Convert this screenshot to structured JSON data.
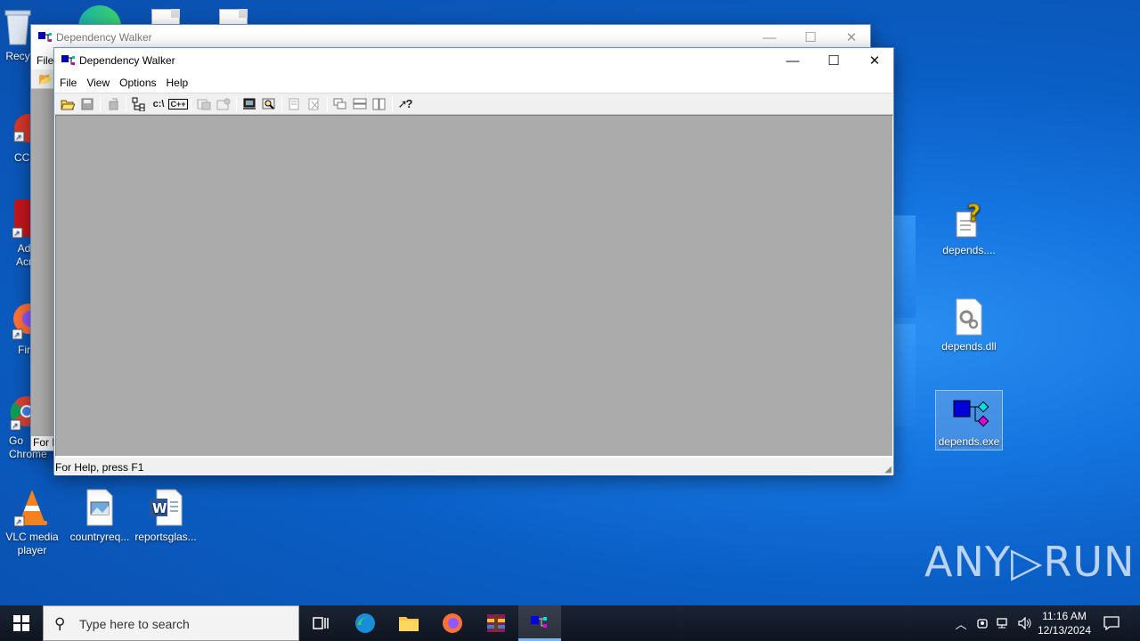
{
  "desktop": {
    "left_icons": [
      {
        "name": "recycle",
        "label": "Recy"
      },
      {
        "name": "ccleaner",
        "label": "CCl"
      },
      {
        "name": "acrobat",
        "label": "Ad\nAcr"
      },
      {
        "name": "firefox",
        "label": "Fir"
      },
      {
        "name": "chrome",
        "label": "Go\nChrome"
      }
    ],
    "bottom_icons": [
      {
        "label": "VLC media player"
      },
      {
        "label": "countryreq..."
      },
      {
        "label": "reportsglas..."
      }
    ],
    "right_icons": [
      {
        "label": "depends...."
      },
      {
        "label": "depends.dll"
      },
      {
        "label": "depends.exe"
      }
    ]
  },
  "back_window": {
    "title": "Dependency Walker",
    "menu_first": "File",
    "status_fragment": "For H"
  },
  "front_window": {
    "title": "Dependency Walker",
    "menu": [
      "File",
      "View",
      "Options",
      "Help"
    ],
    "toolbar_glyphs": {
      "c_drive": "c:\\",
      "cpp": "C++",
      "help": "?"
    },
    "status": "For Help, press F1"
  },
  "taskbar": {
    "search_placeholder": "Type here to search",
    "time": "11:16 AM",
    "date": "12/13/2024"
  },
  "watermark": "ANY▷RUN",
  "colors": {
    "desktop_blue": "#0a5ec4",
    "client_gray": "#ababab",
    "taskbar": "#0e1520"
  }
}
